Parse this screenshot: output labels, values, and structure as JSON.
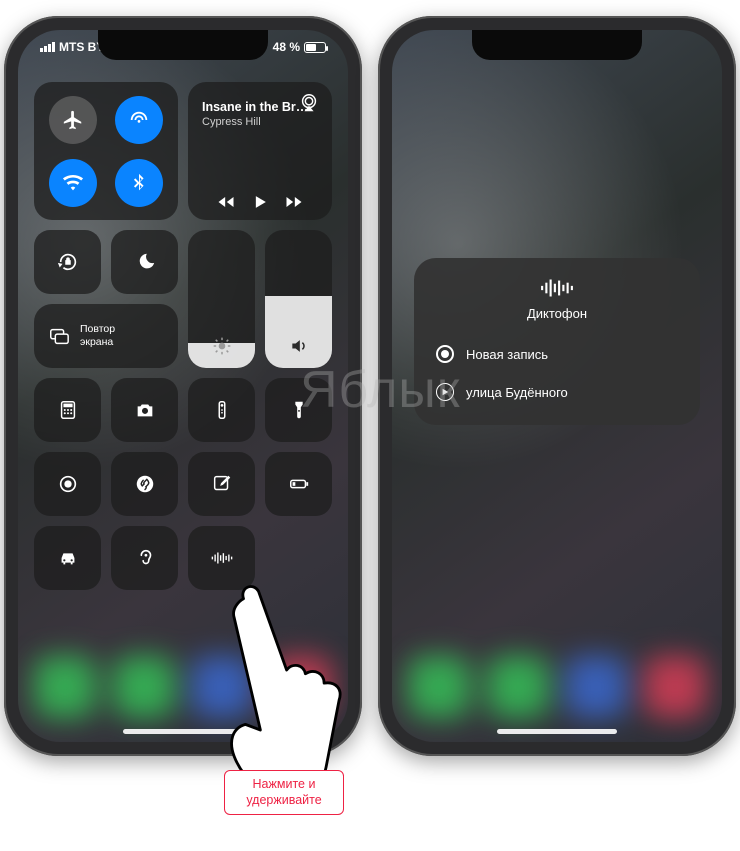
{
  "status": {
    "carrier": "MTS BY",
    "battery_label": "48 %",
    "battery_level_pct": 48
  },
  "connectivity": {
    "airplane_on": false,
    "cellular_on": true,
    "wifi_on": true,
    "bluetooth_on": true
  },
  "music": {
    "title": "Insane in the Br…",
    "artist": "Cypress Hill"
  },
  "screen_mirroring": {
    "label": "Повтор\nэкрана"
  },
  "sliders": {
    "brightness_pct": 18,
    "volume_pct": 52
  },
  "toggles": {
    "orientation_lock": true,
    "do_not_disturb": false
  },
  "shortcuts": {
    "row5": [
      "calculator",
      "camera",
      "apple-tv-remote",
      "flashlight"
    ],
    "row6": [
      "screen-record",
      "shazam",
      "notes",
      "low-power"
    ],
    "row7": [
      "carplay",
      "hearing",
      "voice-memos"
    ]
  },
  "voice_memo_popup": {
    "title": "Диктофон",
    "items": [
      {
        "kind": "new",
        "label": "Новая запись"
      },
      {
        "kind": "play",
        "label": "улица Будённого"
      }
    ]
  },
  "hint": {
    "line1": "Нажмите и",
    "line2": "удерживайте"
  },
  "watermark": "Яблык"
}
